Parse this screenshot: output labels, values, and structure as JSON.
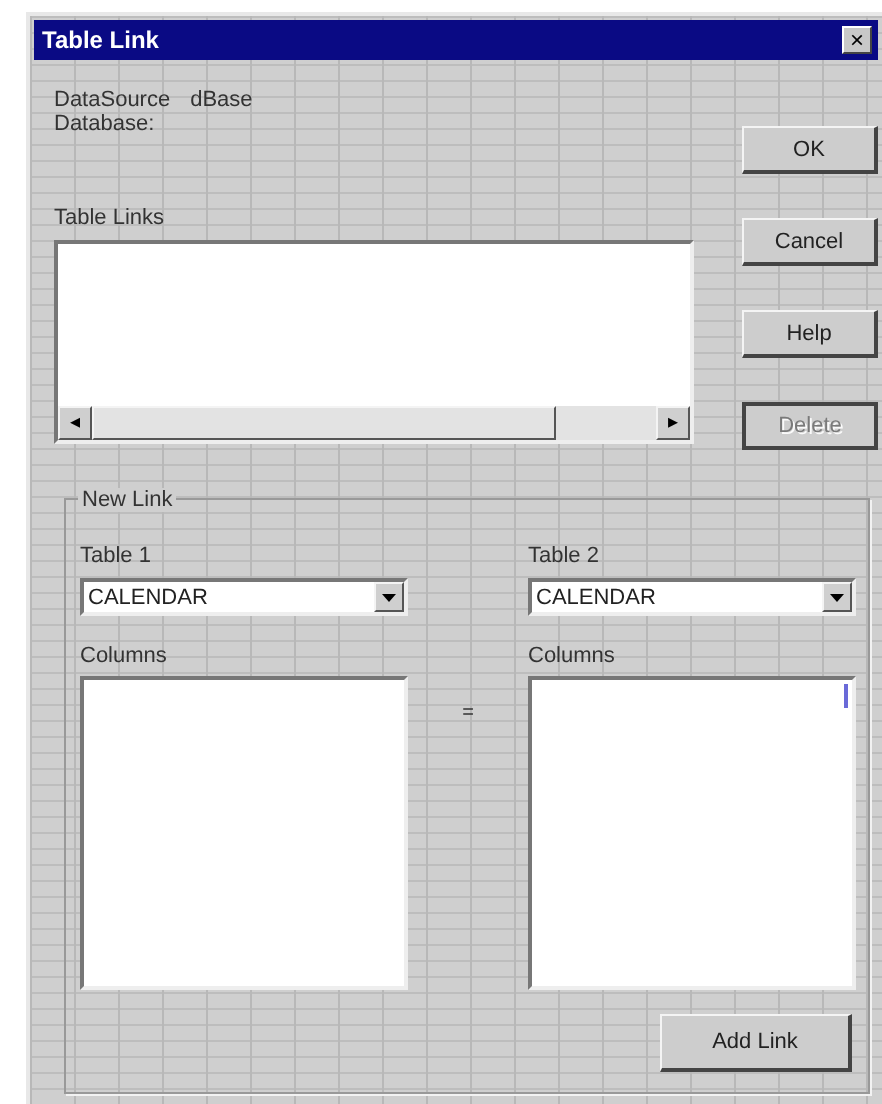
{
  "window": {
    "title": "Table Link",
    "close": "×"
  },
  "info": {
    "datasource_label": "DataSource",
    "datasource_value": "dBase",
    "database_label": "Database:"
  },
  "table_links": {
    "label": "Table Links",
    "scroll_left": "◂",
    "scroll_right": "▸"
  },
  "buttons": [
    {
      "label": "OK",
      "disabled": false
    },
    {
      "label": "Cancel",
      "disabled": false
    },
    {
      "label": "Help",
      "disabled": false
    },
    {
      "label": "Delete",
      "disabled": true
    }
  ],
  "new_link": {
    "title": "New Link",
    "tables": [
      {
        "label": "Table 1",
        "value": "CALENDAR",
        "columns_label": "Columns",
        "focused": false
      },
      {
        "label": "Table 2",
        "value": "CALENDAR",
        "columns_label": "Columns",
        "focused": true
      }
    ],
    "equals": "=",
    "add_button": "Add Link"
  }
}
